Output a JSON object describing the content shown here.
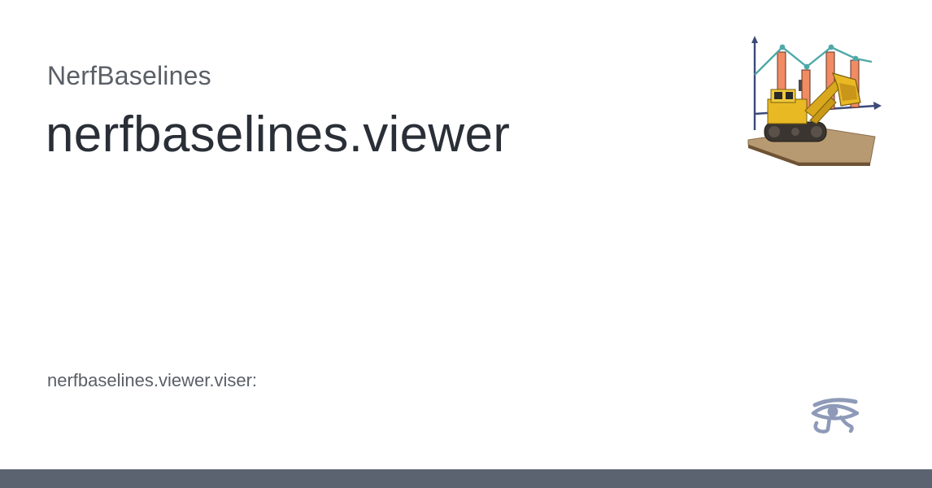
{
  "project_name": "NerfBaselines",
  "page_title": "nerfbaselines.viewer",
  "page_subtitle": "nerfbaselines.viewer.viser:",
  "logo": {
    "icon": "nerfbaselines-logo-icon"
  },
  "footer": {
    "icon": "eye-of-horus-icon"
  },
  "colors": {
    "background": "#ffffff",
    "title": "#2a2f37",
    "muted_text": "#5a5f67",
    "footer_bar": "#5c6370",
    "eye_icon": "#8e9ab8",
    "chart_line": "#4fa8a8",
    "chart_bar": "#f28b63",
    "axis": "#3b4a7a",
    "bulldozer": "#e8b923"
  }
}
